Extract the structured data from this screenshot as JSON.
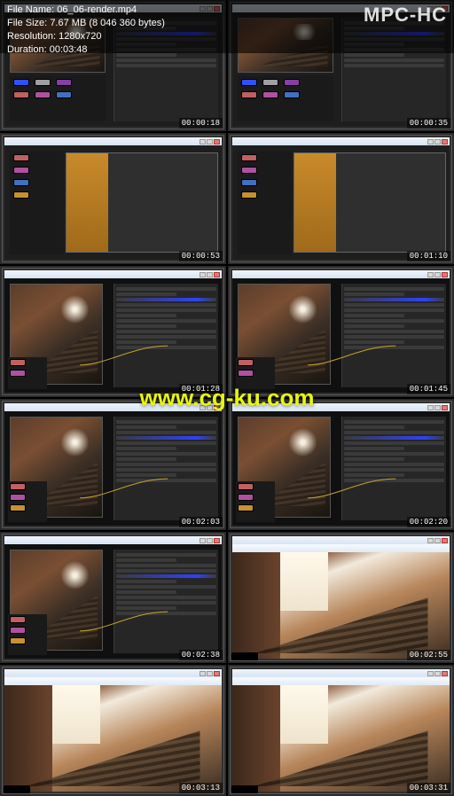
{
  "app": {
    "name": "MPC-HC"
  },
  "file": {
    "name_label": "File Name:",
    "name": "06_06-render.mp4",
    "size_label": "File Size:",
    "size": "7.67 MB (8 046 360 bytes)",
    "res_label": "Resolution:",
    "res": "1280x720",
    "dur_label": "Duration:",
    "dur": "00:03:48"
  },
  "watermark": "www.cg-ku.com",
  "timestamps": [
    "00:00:18",
    "00:00:35",
    "00:00:53",
    "00:01:10",
    "00:01:28",
    "00:01:45",
    "00:02:03",
    "00:02:20",
    "00:02:38",
    "00:02:55",
    "00:03:13",
    "00:03:31"
  ]
}
